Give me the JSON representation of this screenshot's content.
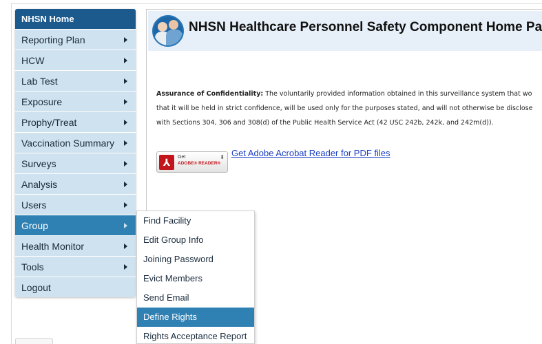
{
  "sidebar": {
    "header": "NHSN Home",
    "items": [
      {
        "label": "Reporting Plan",
        "arrow": true
      },
      {
        "label": "HCW",
        "arrow": true
      },
      {
        "label": "Lab Test",
        "arrow": true
      },
      {
        "label": "Exposure",
        "arrow": true
      },
      {
        "label": "Prophy/Treat",
        "arrow": true
      },
      {
        "label": "Vaccination Summary",
        "arrow": true
      },
      {
        "label": "Surveys",
        "arrow": true
      },
      {
        "label": "Analysis",
        "arrow": true
      },
      {
        "label": "Users",
        "arrow": true
      },
      {
        "label": "Group",
        "arrow": true,
        "active": true
      },
      {
        "label": "Health Monitor",
        "arrow": true
      },
      {
        "label": "Tools",
        "arrow": true
      },
      {
        "label": "Logout",
        "arrow": false
      }
    ]
  },
  "banner": {
    "title": "NHSN Healthcare Personnel Safety Component Home Page"
  },
  "confidentiality": {
    "heading": "Assurance of Confidentiality:",
    "line1": " The voluntarily provided information obtained in this surveillance system that wo",
    "line2": "that it will be held in strict confidence, will be used only for the purposes stated, and will not otherwise be disclose",
    "line3": "with Sections 304, 306 and 308(d) of the Public Health Service Act (42 USC 242b, 242k, and 242m(d))."
  },
  "acrobat": {
    "badge_get": "Get",
    "badge_reader": "ADOBE® READER®",
    "link": "Get Adobe Acrobat Reader for PDF files"
  },
  "submenu": {
    "items": [
      {
        "label": "Find Facility"
      },
      {
        "label": "Edit Group Info"
      },
      {
        "label": "Joining Password"
      },
      {
        "label": "Evict Members"
      },
      {
        "label": "Send Email"
      },
      {
        "label": "Define Rights",
        "highlight": true
      },
      {
        "label": "Rights Acceptance Report"
      }
    ]
  },
  "colors": {
    "nav_header": "#1c5a8d",
    "nav_item": "#cfe2f0",
    "nav_active": "#2f80b3",
    "link": "#1a3fc4"
  }
}
